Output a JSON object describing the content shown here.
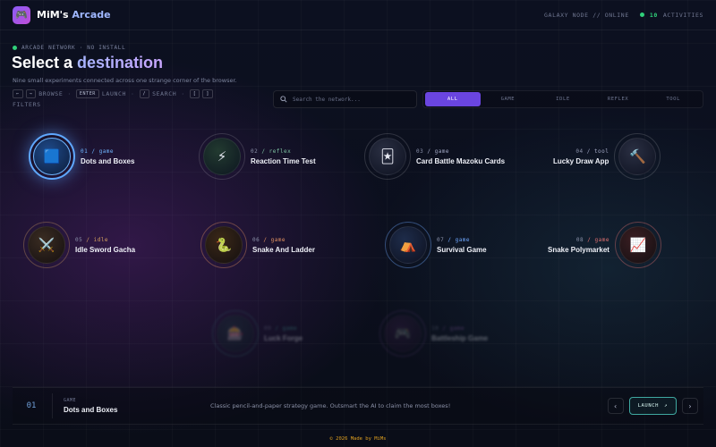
{
  "header": {
    "logo_icon": "🎮",
    "brand_main": "MiM's",
    "brand_accent": "Arcade",
    "status_text": "GALAXY NODE // ONLINE",
    "activity_count": "10",
    "activity_label": "ACTIVITIES"
  },
  "hero": {
    "eyebrow": "ARCADE NETWORK · NO INSTALL",
    "title_main": "Select a ",
    "title_accent": "destination",
    "subtitle": "Nine small experiments connected across one strange corner of the browser.",
    "shortcuts": {
      "browse_keys": [
        "←",
        "→"
      ],
      "browse": "BROWSE",
      "launch_key": "ENTER",
      "launch": "LAUNCH",
      "search_key": "/",
      "search": "SEARCH",
      "filter_keys": [
        "[",
        "]"
      ],
      "filters": "FILTERS"
    }
  },
  "search": {
    "placeholder": "Search the network...",
    "icon": "search-icon"
  },
  "filters": [
    "ALL",
    "GAME",
    "IDLE",
    "REFLEX",
    "TOOL"
  ],
  "active_filter": "ALL",
  "nodes": [
    {
      "num": "01",
      "tag": "game",
      "label": "Dots and Boxes",
      "icon": "🟦",
      "color": "#6fb6ff"
    },
    {
      "num": "02",
      "tag": "reflex",
      "label": "Reaction Time Test",
      "icon": "⚡",
      "color": "#7cc0a0"
    },
    {
      "num": "03",
      "tag": "game",
      "label": "Card Battle Mazoku Cards",
      "icon": "🃏",
      "color": "#a2a8c4"
    },
    {
      "num": "04",
      "tag": "tool",
      "label": "Lucky Draw App",
      "icon": "🔨",
      "color": "#a2a8c4"
    },
    {
      "num": "05",
      "tag": "idle",
      "label": "Idle Sword Gacha",
      "icon": "⚔️",
      "color": "#d4a060"
    },
    {
      "num": "06",
      "tag": "game",
      "label": "Snake And Ladder",
      "icon": "🐍",
      "color": "#e09060"
    },
    {
      "num": "07",
      "tag": "game",
      "label": "Survival Game",
      "icon": "⛺",
      "color": "#6fa8ff"
    },
    {
      "num": "08",
      "tag": "game",
      "label": "Snake Polymarket",
      "icon": "📈",
      "color": "#e07070"
    },
    {
      "num": "09",
      "tag": "game",
      "label": "Luck Forge",
      "icon": "🎰",
      "color": "#4ec0b0"
    },
    {
      "num": "10",
      "tag": "game",
      "label": "Battleship Game",
      "icon": "🎮",
      "color": "#b070d0"
    }
  ],
  "selected": {
    "index": "01",
    "kind": "GAME",
    "name": "Dots and Boxes",
    "description": "Classic pencil-and-paper strategy game. Outsmart the AI to claim the most boxes!",
    "launch_label": "LAUNCH",
    "launch_icon": "↗",
    "prev_icon": "‹",
    "next_icon": "›"
  },
  "footer": "© 2026 Made by MiMs"
}
